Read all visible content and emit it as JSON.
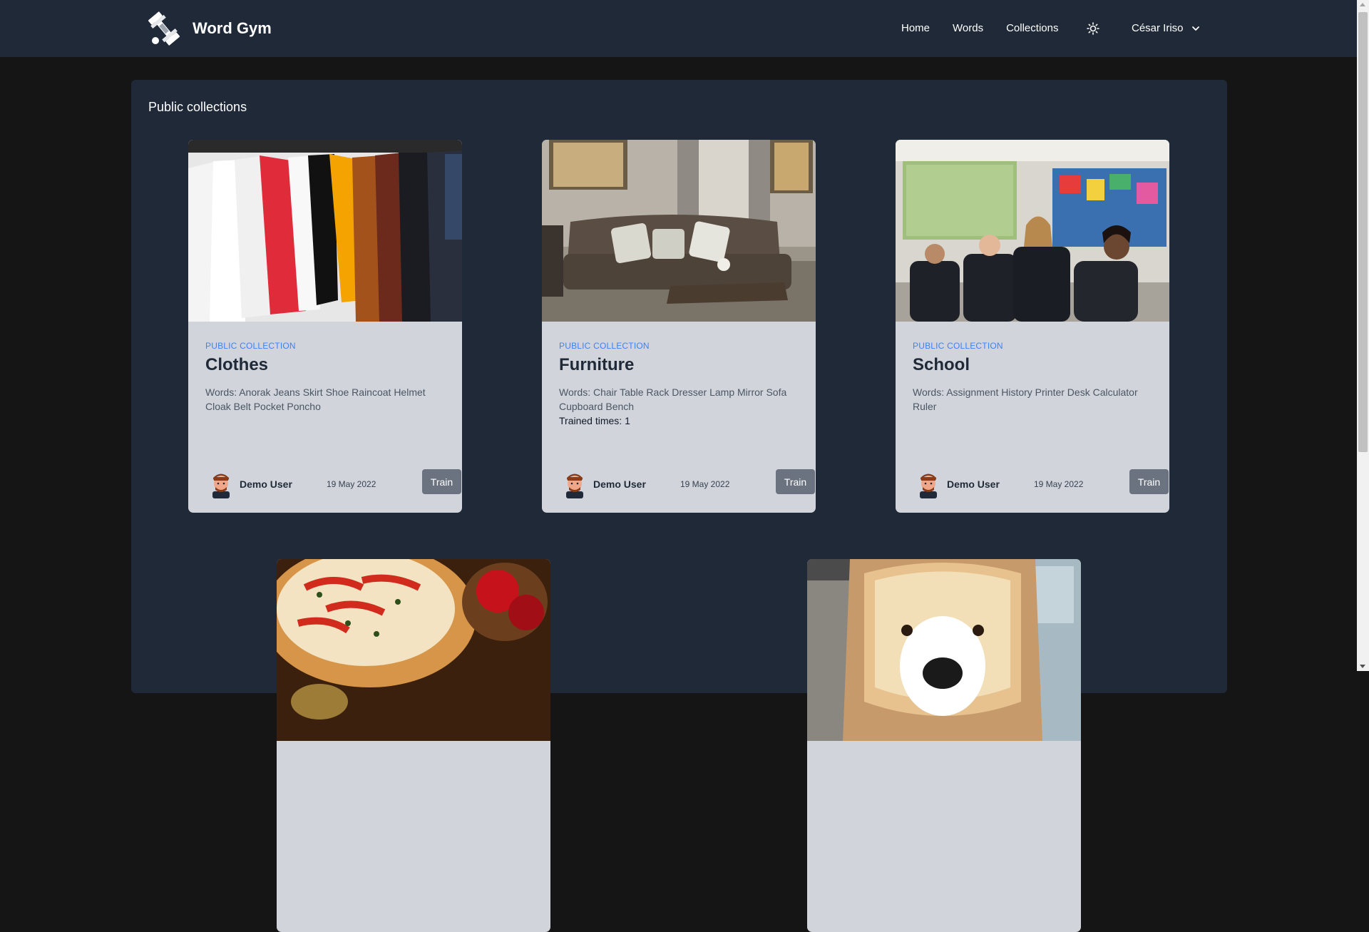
{
  "app": {
    "brand": "Word Gym"
  },
  "nav": {
    "links": [
      "Home",
      "Words",
      "Collections"
    ],
    "theme_icon": "sun-icon",
    "user": "César Iriso"
  },
  "page": {
    "title": "Public collections"
  },
  "collections": [
    {
      "kicker": "PUBLIC COLLECTION",
      "title": "Clothes",
      "words": "Words: Anorak Jeans Skirt Shoe Raincoat Helmet Cloak Belt Pocket Poncho",
      "trained": "",
      "author": "Demo User",
      "date": "19 May 2022",
      "action": "Train"
    },
    {
      "kicker": "PUBLIC COLLECTION",
      "title": "Furniture",
      "words": "Words: Chair Table Rack Dresser Lamp Mirror Sofa Cupboard Bench",
      "trained": "Trained times: 1",
      "author": "Demo User",
      "date": "19 May 2022",
      "action": "Train"
    },
    {
      "kicker": "PUBLIC COLLECTION",
      "title": "School",
      "words": "Words: Assignment History Printer Desk Calculator Ruler",
      "trained": "",
      "author": "Demo User",
      "date": "19 May 2022",
      "action": "Train"
    }
  ],
  "colors": {
    "navbar": "#1f2937",
    "page_bg": "#151515",
    "card_bg": "#d1d5db",
    "kicker": "#3b82f6",
    "train_button": "#6b7280"
  }
}
